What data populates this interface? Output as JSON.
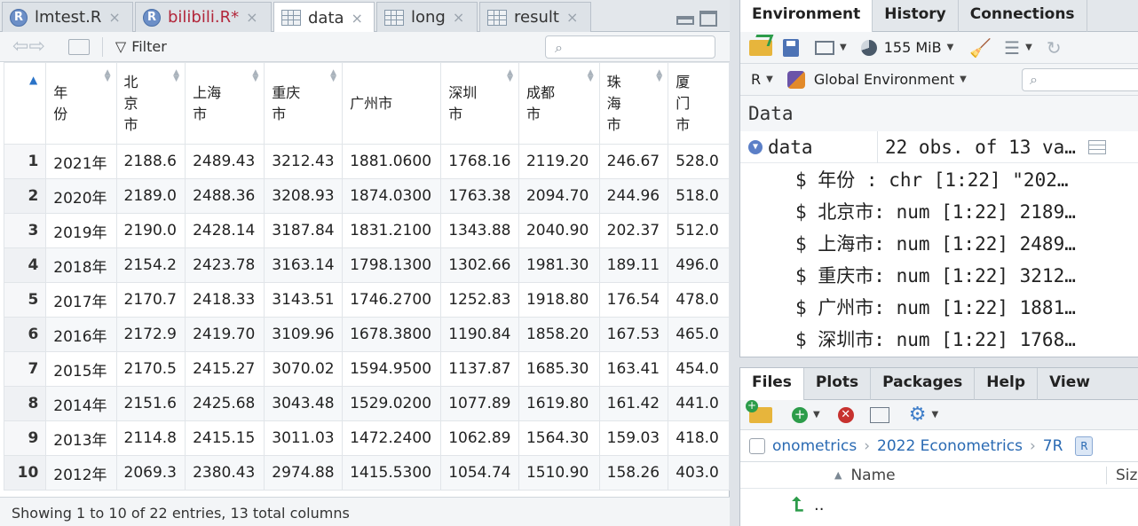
{
  "editor": {
    "tabs": [
      {
        "label": "lmtest.R",
        "kind": "r"
      },
      {
        "label": "bilibili.R*",
        "kind": "r-modified"
      },
      {
        "label": "data",
        "kind": "table"
      },
      {
        "label": "long",
        "kind": "table"
      },
      {
        "label": "result",
        "kind": "table"
      }
    ],
    "close_glyph": "×",
    "filter_label": "Filter",
    "columns": [
      "年份",
      "北京市",
      "上海市",
      "重庆市",
      "广州市",
      "深圳市",
      "成都市",
      "珠海市",
      "厦门市"
    ],
    "rows": [
      {
        "idx": "1",
        "cells": [
          "2021年",
          "2188.6",
          "2489.43",
          "3212.43",
          "1881.0600",
          "1768.16",
          "2119.20",
          "246.67",
          "528.0"
        ]
      },
      {
        "idx": "2",
        "cells": [
          "2020年",
          "2189.0",
          "2488.36",
          "3208.93",
          "1874.0300",
          "1763.38",
          "2094.70",
          "244.96",
          "518.0"
        ]
      },
      {
        "idx": "3",
        "cells": [
          "2019年",
          "2190.0",
          "2428.14",
          "3187.84",
          "1831.2100",
          "1343.88",
          "2040.90",
          "202.37",
          "512.0"
        ]
      },
      {
        "idx": "4",
        "cells": [
          "2018年",
          "2154.2",
          "2423.78",
          "3163.14",
          "1798.1300",
          "1302.66",
          "1981.30",
          "189.11",
          "496.0"
        ]
      },
      {
        "idx": "5",
        "cells": [
          "2017年",
          "2170.7",
          "2418.33",
          "3143.51",
          "1746.2700",
          "1252.83",
          "1918.80",
          "176.54",
          "478.0"
        ]
      },
      {
        "idx": "6",
        "cells": [
          "2016年",
          "2172.9",
          "2419.70",
          "3109.96",
          "1678.3800",
          "1190.84",
          "1858.20",
          "167.53",
          "465.0"
        ]
      },
      {
        "idx": "7",
        "cells": [
          "2015年",
          "2170.5",
          "2415.27",
          "3070.02",
          "1594.9500",
          "1137.87",
          "1685.30",
          "163.41",
          "454.0"
        ]
      },
      {
        "idx": "8",
        "cells": [
          "2014年",
          "2151.6",
          "2425.68",
          "3043.48",
          "1529.0200",
          "1077.89",
          "1619.80",
          "161.42",
          "441.0"
        ]
      },
      {
        "idx": "9",
        "cells": [
          "2013年",
          "2114.8",
          "2415.15",
          "3011.03",
          "1472.2400",
          "1062.89",
          "1564.30",
          "159.03",
          "418.0"
        ]
      },
      {
        "idx": "10",
        "cells": [
          "2012年",
          "2069.3",
          "2380.43",
          "2974.88",
          "1415.5300",
          "1054.74",
          "1510.90",
          "158.26",
          "403.0"
        ]
      }
    ],
    "status": "Showing 1 to 10 of 22 entries, 13 total columns"
  },
  "env_pane": {
    "tabs": [
      "Environment",
      "History",
      "Connections"
    ],
    "memory": "155 MiB",
    "language": "R",
    "scope": "Global Environment",
    "section": "Data",
    "object": {
      "name": "data",
      "summary": "22 obs. of 13 va…"
    },
    "vars": [
      "$ 年份  : chr [1:22] \"202…",
      "$ 北京市: num [1:22] 2189…",
      "$ 上海市: num [1:22] 2489…",
      "$ 重庆市: num [1:22] 3212…",
      "$ 广州市: num [1:22] 1881…",
      "$ 深圳市: num [1:22] 1768…"
    ]
  },
  "files_pane": {
    "tabs": [
      "Files",
      "Plots",
      "Packages",
      "Help",
      "View"
    ],
    "breadcrumb": [
      "onometrics",
      "2022 Econometrics",
      "7R"
    ],
    "col_name": "Name",
    "col_size": "Siz",
    "parent_dir": ".."
  }
}
